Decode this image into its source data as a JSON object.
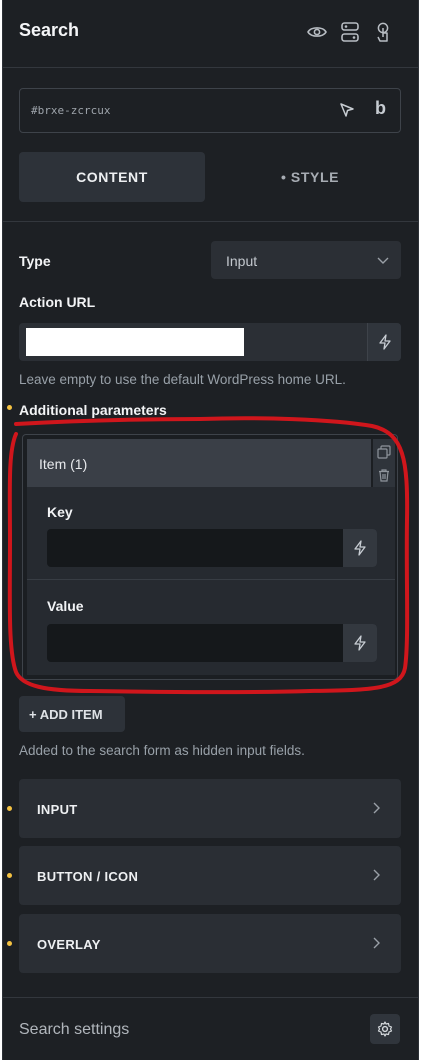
{
  "header": {
    "title": "Search",
    "icons": [
      "eye-icon",
      "layout-toggle-icon",
      "pointer-finger-icon"
    ]
  },
  "element_id": {
    "value": "#brxe-zcrcux",
    "icons": [
      "cursor-arrow-icon",
      "bold-b-icon"
    ],
    "bold_label": "b"
  },
  "tabs": {
    "content": "CONTENT",
    "style": "• STYLE"
  },
  "controls": {
    "type_label": "Type",
    "type_value": "Input",
    "action_url_label": "Action URL",
    "action_url_help": "Leave empty to use the default WordPress home URL.",
    "additional_params_label": "Additional parameters"
  },
  "repeater": {
    "item_title": "Item (1)",
    "key_label": "Key",
    "value_label": "Value",
    "add_item_label": "+ ADD ITEM",
    "help": "Added to the search form as hidden input fields."
  },
  "accordions": [
    {
      "label": "INPUT"
    },
    {
      "label": "BUTTON / ICON"
    },
    {
      "label": "OVERLAY"
    }
  ],
  "footer": {
    "label": "Search settings",
    "icon": "gear-icon"
  },
  "colors": {
    "panel_bg": "#1d2024",
    "indicator_dot": "#f5c242",
    "annotation_red": "#d0161c"
  }
}
